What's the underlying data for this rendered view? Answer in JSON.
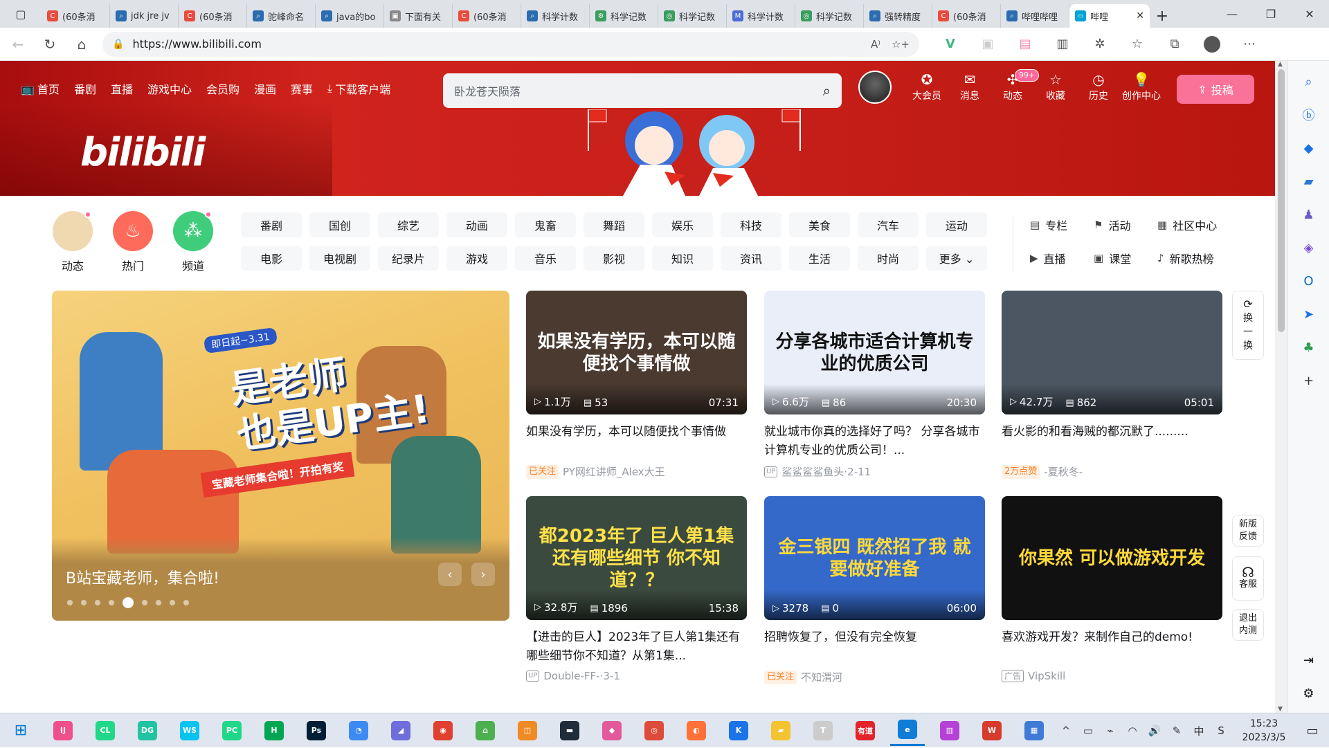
{
  "browser": {
    "tabs": [
      {
        "label": "(60条消",
        "color": "#e74c3c",
        "glyph": "C"
      },
      {
        "label": "jdk jre jv",
        "color": "#2b6cb0",
        "glyph": "⌕"
      },
      {
        "label": "(60条消",
        "color": "#e74c3c",
        "glyph": "C"
      },
      {
        "label": "驼峰命名",
        "color": "#2b6cb0",
        "glyph": "⌕"
      },
      {
        "label": "java的bo",
        "color": "#2b6cb0",
        "glyph": "⌕"
      },
      {
        "label": "下面有关",
        "color": "#888888",
        "glyph": "▣"
      },
      {
        "label": "(60条消",
        "color": "#e74c3c",
        "glyph": "C"
      },
      {
        "label": "科学计数",
        "color": "#2b6cb0",
        "glyph": "⌕"
      },
      {
        "label": "科学记数",
        "color": "#3a9d5d",
        "glyph": "⚙"
      },
      {
        "label": "科学记数",
        "color": "#3a9d5d",
        "glyph": "◎"
      },
      {
        "label": "科学计数",
        "color": "#4f6bd6",
        "glyph": "M"
      },
      {
        "label": "科学记数",
        "color": "#3a9d5d",
        "glyph": "◎"
      },
      {
        "label": "强转精度",
        "color": "#2b6cb0",
        "glyph": "⌕"
      },
      {
        "label": "(60条消",
        "color": "#e74c3c",
        "glyph": "C"
      },
      {
        "label": "哔哩哔哩",
        "color": "#2b6cb0",
        "glyph": "⌕"
      }
    ],
    "active_tab": {
      "label": "哔哩",
      "color": "#00a1d6",
      "glyph": "▭"
    },
    "url": "https://www.bilibili.com",
    "read_aloud": "A⁾"
  },
  "nav": {
    "left": [
      {
        "icon": "📺",
        "label": "首页"
      },
      {
        "icon": "",
        "label": "番剧"
      },
      {
        "icon": "",
        "label": "直播"
      },
      {
        "icon": "",
        "label": "游戏中心"
      },
      {
        "icon": "",
        "label": "会员购"
      },
      {
        "icon": "",
        "label": "漫画"
      },
      {
        "icon": "",
        "label": "赛事"
      },
      {
        "icon": "⤓",
        "label": "下载客户端"
      }
    ],
    "search_placeholder": "卧龙苍天陨落",
    "right": [
      {
        "icon": "✪",
        "label": "大会员",
        "badge": ""
      },
      {
        "icon": "✉",
        "label": "消息",
        "badge": ""
      },
      {
        "icon": "✣",
        "label": "动态",
        "badge": "99+"
      },
      {
        "icon": "☆",
        "label": "收藏",
        "badge": ""
      },
      {
        "icon": "◷",
        "label": "历史",
        "badge": ""
      },
      {
        "icon": "💡",
        "label": "创作中心",
        "badge": ""
      }
    ],
    "post_label": "投稿",
    "post_icon": "⇪"
  },
  "banner": {
    "logo": "bilibili"
  },
  "channels": {
    "entries": [
      {
        "label": "动态",
        "color": "#f0d8b0",
        "icon": "",
        "dot": true
      },
      {
        "label": "热门",
        "color": "#ff6b5a",
        "icon": "♨",
        "dot": false
      },
      {
        "label": "频道",
        "color": "#3fcd7c",
        "icon": "⁂",
        "dot": true
      }
    ],
    "chips": [
      "番剧",
      "国创",
      "综艺",
      "动画",
      "鬼畜",
      "舞蹈",
      "娱乐",
      "科技",
      "美食",
      "汽车",
      "运动",
      "电影",
      "电视剧",
      "纪录片",
      "游戏",
      "音乐",
      "影视",
      "知识",
      "资讯",
      "生活",
      "时尚",
      "更多 ⌄"
    ],
    "side": [
      {
        "icon": "▤",
        "label": "专栏"
      },
      {
        "icon": "⚑",
        "label": "活动"
      },
      {
        "icon": "▦",
        "label": "社区中心"
      },
      {
        "icon": "▶",
        "label": "直播"
      },
      {
        "icon": "▣",
        "label": "课堂"
      },
      {
        "icon": "♪",
        "label": "新歌热榜"
      }
    ]
  },
  "carousel": {
    "tag": "即日起~3.31",
    "headline_1": "是老师",
    "headline_2": "也是UP主!",
    "subline": "宝藏老师集合啦！开拍有奖",
    "caption": "B站宝藏老师，集合啦!",
    "dot_count": 9,
    "active_dot": 4
  },
  "videos": [
    {
      "thumb_text": "如果没有学历，本可以随便找个事情做",
      "thumb_bg": "#4a3a30",
      "thumb_fg": "#ffffff",
      "views": "1.1万",
      "danmaku": "53",
      "duration": "07:31",
      "title": "如果没有学历，本可以随便找个事情做",
      "tag": "已关注",
      "owner": "PY网红讲师_Alex大王",
      "date": ""
    },
    {
      "thumb_text": "分享各城市适合计算机专业的优质公司",
      "thumb_bg": "#e9eef9",
      "thumb_fg": "#111111",
      "views": "6.6万",
      "danmaku": "86",
      "duration": "20:30",
      "title": "就业城市你真的选择好了吗？ 分享各城市计算机专业的优质公司！...",
      "tag": "",
      "owner": "鲨鲨鲨鲨鱼头",
      "date": "2-11"
    },
    {
      "thumb_text": "",
      "thumb_bg": "#4b5662",
      "thumb_fg": "#ffffff",
      "views": "42.7万",
      "danmaku": "862",
      "duration": "05:01",
      "title": "看火影的和看海贼的都沉默了.........",
      "tag": "2万点赞",
      "owner": "-夏秋冬-",
      "date": ""
    },
    {
      "thumb_text": "都2023年了 巨人第1集 还有哪些细节 你不知道？？",
      "thumb_bg": "#3b4a3f",
      "thumb_fg": "#ffe14a",
      "views": "32.8万",
      "danmaku": "1896",
      "duration": "15:38",
      "title": "【进击的巨人】2023年了巨人第1集还有哪些细节你不知道？从第1集...",
      "tag": "",
      "owner": "Double-FF-",
      "date": "3-1"
    },
    {
      "thumb_text": "金三银四 既然招了我 就要做好准备",
      "thumb_bg": "#3569c9",
      "thumb_fg": "#ffd93a",
      "views": "3278",
      "danmaku": "0",
      "duration": "06:00",
      "title": "招聘恢复了，但没有完全恢复",
      "tag": "已关注",
      "owner": "不知渭河",
      "date": ""
    },
    {
      "thumb_text": "你果然 可以做游戏开发",
      "thumb_bg": "#111111",
      "thumb_fg": "#ffd93a",
      "views": "",
      "danmaku": "",
      "duration": "",
      "title": "喜欢游戏开发？来制作自己的demo!",
      "tag": "广告",
      "owner": "VipSkill",
      "date": ""
    }
  ],
  "float": {
    "refresh": [
      "换",
      "一",
      "换"
    ],
    "feedback": "新版反馈",
    "service": "客服",
    "exit": "退出内测"
  },
  "taskbar": {
    "apps": [
      {
        "glyph": "IJ",
        "color": "#f04f8b"
      },
      {
        "glyph": "CL",
        "color": "#21d789"
      },
      {
        "glyph": "DG",
        "color": "#22c3a3"
      },
      {
        "glyph": "WS",
        "color": "#07c3f2"
      },
      {
        "glyph": "PC",
        "color": "#21d789"
      },
      {
        "glyph": "H",
        "color": "#00a653"
      },
      {
        "glyph": "Ps",
        "color": "#001e36"
      },
      {
        "glyph": "◔",
        "color": "#3d8bf2"
      },
      {
        "glyph": "◢",
        "color": "#6f6ddb"
      },
      {
        "glyph": "◉",
        "color": "#e0402f"
      },
      {
        "glyph": "⌂",
        "color": "#4caf50"
      },
      {
        "glyph": "◫",
        "color": "#f08a24"
      },
      {
        "glyph": "▬",
        "color": "#1f2c3a"
      },
      {
        "glyph": "◆",
        "color": "#e25a9c"
      },
      {
        "glyph": "◎",
        "color": "#dd4b39"
      },
      {
        "glyph": "◐",
        "color": "#ff7139"
      },
      {
        "glyph": "K",
        "color": "#1a73e8"
      },
      {
        "glyph": "▰",
        "color": "#f4c430"
      },
      {
        "glyph": "T",
        "color": "#cccccc"
      },
      {
        "glyph": "有道",
        "color": "#e3242b"
      },
      {
        "glyph": "e",
        "color": "#0f7cd8"
      },
      {
        "glyph": "▥",
        "color": "#b541d6"
      },
      {
        "glyph": "W",
        "color": "#d63b2b"
      },
      {
        "glyph": "▦",
        "color": "#3f7bd6"
      }
    ],
    "active_index": 20,
    "tray": [
      "^",
      "▭",
      "⌁",
      "◠",
      "🔊",
      "✎",
      "中",
      "S"
    ],
    "time": "15:23",
    "date": "2023/3/5"
  }
}
